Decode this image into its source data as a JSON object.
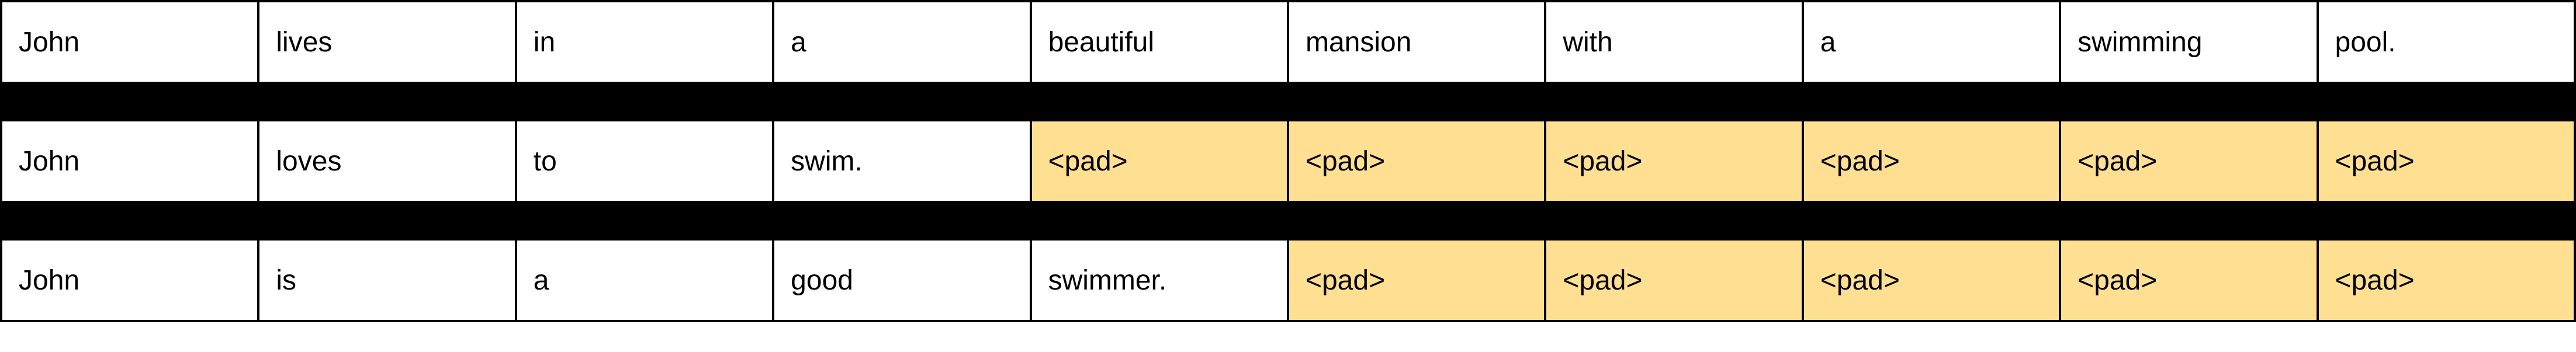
{
  "pad_token": "<pad>",
  "columns": 10,
  "rows": [
    {
      "cells": [
        {
          "text": "John",
          "pad": false
        },
        {
          "text": "lives",
          "pad": false
        },
        {
          "text": "in",
          "pad": false
        },
        {
          "text": "a",
          "pad": false
        },
        {
          "text": "beautiful",
          "pad": false
        },
        {
          "text": "mansion",
          "pad": false
        },
        {
          "text": "with",
          "pad": false
        },
        {
          "text": "a",
          "pad": false
        },
        {
          "text": "swimming",
          "pad": false
        },
        {
          "text": "pool.",
          "pad": false
        }
      ]
    },
    {
      "cells": [
        {
          "text": "John",
          "pad": false
        },
        {
          "text": "loves",
          "pad": false
        },
        {
          "text": "to",
          "pad": false
        },
        {
          "text": "swim.",
          "pad": false
        },
        {
          "text": "<pad>",
          "pad": true
        },
        {
          "text": "<pad>",
          "pad": true
        },
        {
          "text": "<pad>",
          "pad": true
        },
        {
          "text": "<pad>",
          "pad": true
        },
        {
          "text": "<pad>",
          "pad": true
        },
        {
          "text": "<pad>",
          "pad": true
        }
      ]
    },
    {
      "cells": [
        {
          "text": "John",
          "pad": false
        },
        {
          "text": "is",
          "pad": false
        },
        {
          "text": "a",
          "pad": false
        },
        {
          "text": "good",
          "pad": false
        },
        {
          "text": "swimmer.",
          "pad": false
        },
        {
          "text": "<pad>",
          "pad": true
        },
        {
          "text": "<pad>",
          "pad": true
        },
        {
          "text": "<pad>",
          "pad": true
        },
        {
          "text": "<pad>",
          "pad": true
        },
        {
          "text": "<pad>",
          "pad": true
        }
      ]
    }
  ]
}
